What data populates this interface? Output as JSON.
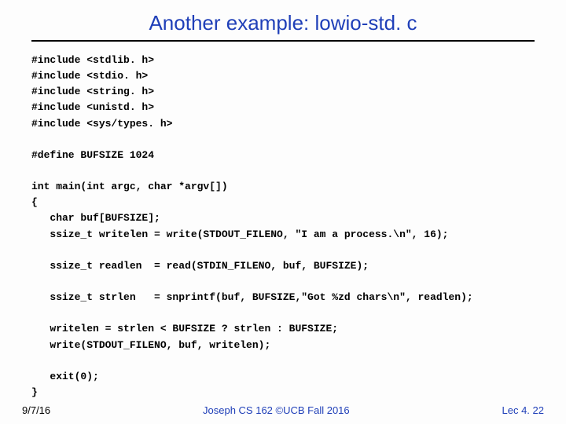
{
  "title": "Another example: lowio-std. c",
  "code": "#include <stdlib. h>\n#include <stdio. h>\n#include <string. h>\n#include <unistd. h>\n#include <sys/types. h>\n\n#define BUFSIZE 1024\n\nint main(int argc, char *argv[])\n{\n   char buf[BUFSIZE];\n   ssize_t writelen = write(STDOUT_FILENO, \"I am a process.\\n\", 16);\n\n   ssize_t readlen  = read(STDIN_FILENO, buf, BUFSIZE);\n\n   ssize_t strlen   = snprintf(buf, BUFSIZE,\"Got %zd chars\\n\", readlen);\n\n   writelen = strlen < BUFSIZE ? strlen : BUFSIZE;\n   write(STDOUT_FILENO, buf, writelen);\n\n   exit(0);\n}",
  "footer": {
    "left": "9/7/16",
    "center": "Joseph CS 162 ©UCB Fall 2016",
    "right": "Lec 4. 22"
  }
}
